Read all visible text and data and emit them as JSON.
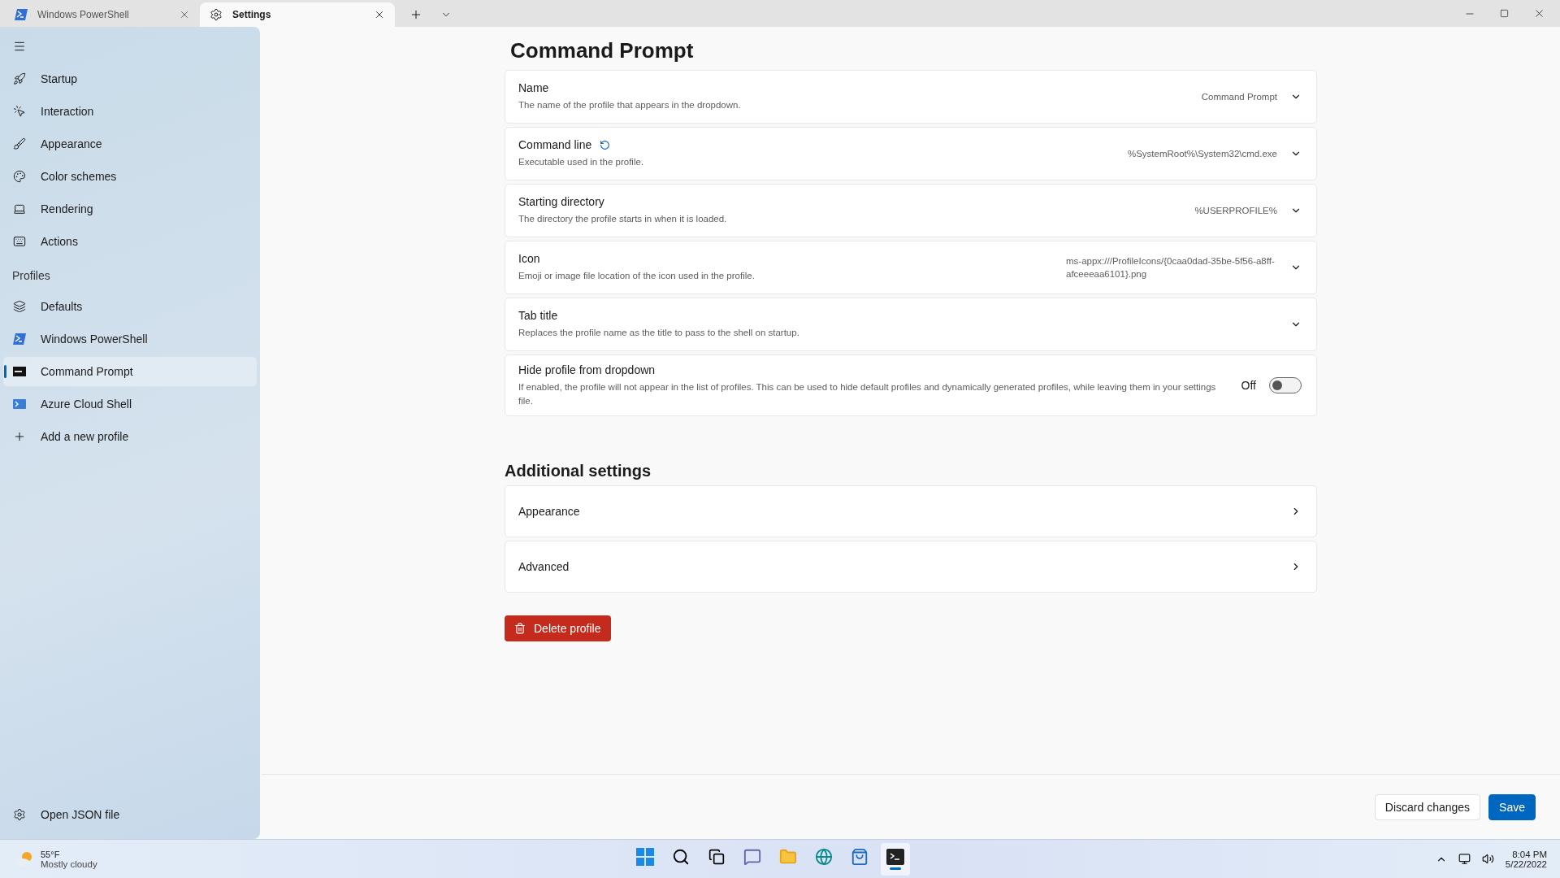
{
  "tabs": [
    {
      "label": "Windows PowerShell",
      "selected": false
    },
    {
      "label": "Settings",
      "selected": true
    }
  ],
  "sidebar": {
    "items": [
      {
        "kind": "nav",
        "label": "Startup",
        "selected": false
      },
      {
        "kind": "nav",
        "label": "Interaction",
        "selected": false
      },
      {
        "kind": "nav",
        "label": "Appearance",
        "selected": false
      },
      {
        "kind": "nav",
        "label": "Color schemes",
        "selected": false
      },
      {
        "kind": "nav",
        "label": "Rendering",
        "selected": false
      },
      {
        "kind": "nav",
        "label": "Actions",
        "selected": false
      },
      {
        "kind": "header",
        "label": "Profiles"
      },
      {
        "kind": "nav",
        "label": "Defaults",
        "selected": false
      },
      {
        "kind": "nav",
        "label": "Windows PowerShell",
        "selected": false
      },
      {
        "kind": "nav",
        "label": "Command Prompt",
        "selected": true
      },
      {
        "kind": "nav",
        "label": "Azure Cloud Shell",
        "selected": false
      },
      {
        "kind": "nav",
        "label": "Add a new profile",
        "selected": false
      }
    ],
    "footer": {
      "label": "Open JSON file"
    }
  },
  "page_title": "Command Prompt",
  "settings": [
    {
      "kind": "dropdown",
      "title": "Name",
      "description": "The name of the profile that appears in the dropdown.",
      "value": "Command Prompt",
      "reset": false
    },
    {
      "kind": "dropdown",
      "title": "Command line",
      "description": "Executable used in the profile.",
      "value": "%SystemRoot%\\System32\\cmd.exe",
      "reset": true
    },
    {
      "kind": "dropdown",
      "title": "Starting directory",
      "description": "The directory the profile starts in when it is loaded.",
      "value": "%USERPROFILE%",
      "reset": false
    },
    {
      "kind": "dropdown",
      "title": "Icon",
      "description": "Emoji or image file location of the icon used in the profile.",
      "value": "ms-appx:///ProfileIcons/{0caa0dad-35be-5f56-a8ff-afceeeaa6101}.png",
      "reset": false
    },
    {
      "kind": "dropdown",
      "title": "Tab title",
      "description": "Replaces the profile name as the title to pass to the shell on startup.",
      "reset": false
    },
    {
      "kind": "toggle",
      "title": "Hide profile from dropdown",
      "description": "If enabled, the profile will not appear in the list of profiles. This can be used to hide default profiles and dynamically generated profiles, while leaving them in your settings file.",
      "state_label": "Off",
      "on": false,
      "reset": false
    }
  ],
  "additional": {
    "heading": "Additional settings",
    "links": [
      "Appearance",
      "Advanced"
    ]
  },
  "delete_button": "Delete profile",
  "footer_buttons": [
    {
      "label": "Discard changes",
      "kind": "secondary"
    },
    {
      "label": "Save",
      "kind": "primary"
    }
  ],
  "taskbar": {
    "weather": {
      "temp": "55°F",
      "condition": "Mostly cloudy"
    },
    "apps": [
      {
        "active": false
      },
      {
        "active": false
      },
      {
        "active": false
      },
      {
        "active": false
      },
      {
        "active": false
      },
      {
        "active": false
      },
      {
        "active": false
      },
      {
        "active": true
      }
    ],
    "time": "8:04 PM",
    "date": "5/22/2022"
  }
}
